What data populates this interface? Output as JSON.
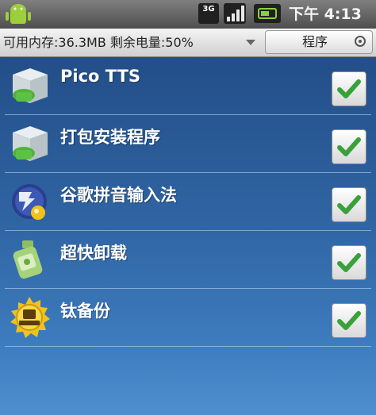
{
  "status_bar": {
    "network_label": "3G",
    "time": "下午 4:13"
  },
  "header": {
    "memory_battery_text": "可用内存:36.3MB 剩余电量:50%",
    "filter_label": "程序"
  },
  "apps": [
    {
      "name": "Pico TTS",
      "icon": "package-box-icon",
      "checked": true
    },
    {
      "name": "打包安装程序",
      "icon": "package-installer-icon",
      "checked": true
    },
    {
      "name": "谷歌拼音输入法",
      "icon": "pinyin-ime-icon",
      "checked": true
    },
    {
      "name": "超快卸载",
      "icon": "uninstall-bottle-icon",
      "checked": true
    },
    {
      "name": "钛备份",
      "icon": "titanium-backup-icon",
      "checked": true
    }
  ],
  "colors": {
    "list_background": "#2f64a2",
    "check_green": "#3aa13a"
  }
}
